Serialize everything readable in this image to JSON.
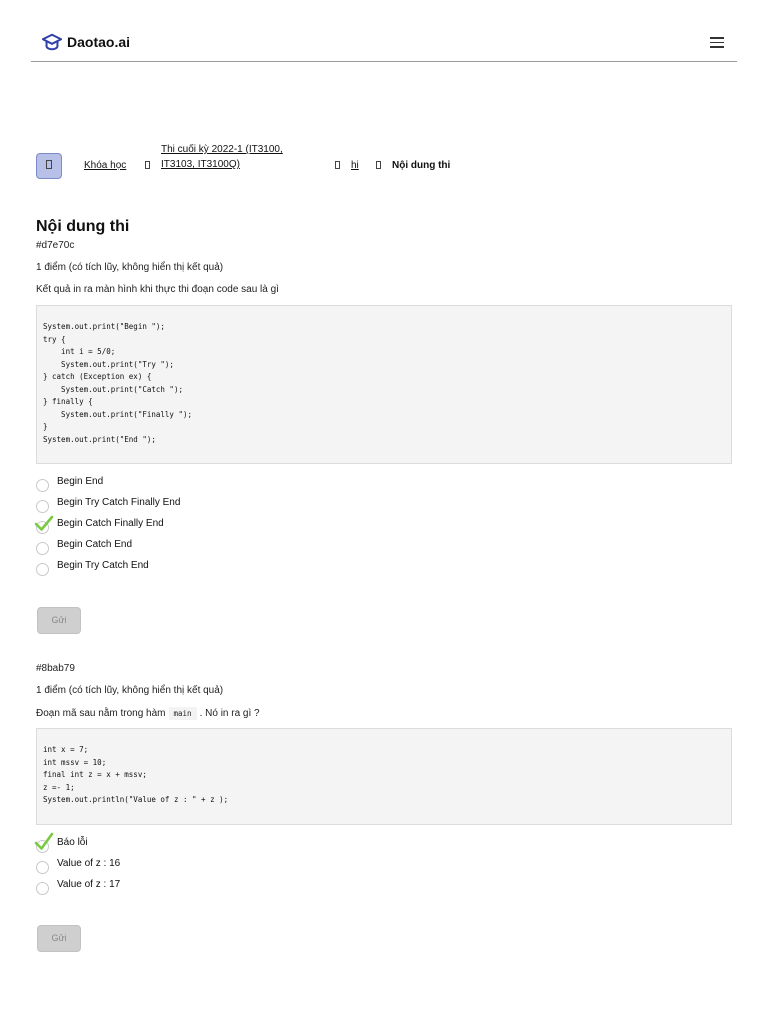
{
  "app": {
    "logo_text": "Daotao.ai"
  },
  "breadcrumb": {
    "items": [
      {
        "label": "Khóa học"
      },
      {
        "label_line1": "Thi cuối kỳ 2022-1 (IT3100,",
        "label_line2": "IT3103, IT3100Q)"
      },
      {
        "label": "hi"
      }
    ],
    "current": "Nội dung thi"
  },
  "page": {
    "title": "Nội dung thi"
  },
  "questions": [
    {
      "id": "#d7e70c",
      "score": "1 điểm (có tích lũy, không hiển thị kết quả)",
      "prompt": "Kết quả in ra màn hình khi thực thi đoạn code sau là gì",
      "code": "System.out.print(\"Begin \");\ntry {\n    int i = 5/0;\n    System.out.print(\"Try \");\n} catch (Exception ex) {\n    System.out.print(\"Catch \");\n} finally {\n    System.out.print(\"Finally \");\n}\nSystem.out.print(\"End \");",
      "options": [
        "Begin End",
        "Begin Try Catch Finally End",
        "Begin Catch Finally End",
        "Begin Catch End",
        "Begin Try Catch End"
      ],
      "selected_index": 2,
      "submit_label": "Gửi"
    },
    {
      "id": "#8bab79",
      "score": "1 điểm (có tích lũy, không hiển thị kết quả)",
      "prompt_before": "Đoạn mã sau nằm trong hàm",
      "prompt_code": "main",
      "prompt_after": ". Nó in ra gì ?",
      "code": "int x = 7;\nint mssv = 10;\nfinal int z = x + mssv;\nz =- 1;\nSystem.out.println(\"Value of z : \" + z );",
      "options": [
        "Báo lỗi",
        "Value of z : 16",
        "Value of z : 17"
      ],
      "selected_index": 0,
      "submit_label": "Gửi"
    }
  ],
  "colors": {
    "check": "#7ac943",
    "home_button": "#b7c0e6",
    "submit_disabled": "#cfcfcf"
  },
  "icons": {
    "logo": "graduation-cap-icon",
    "menu": "hamburger-menu-icon",
    "selected": "checkmark-icon"
  }
}
